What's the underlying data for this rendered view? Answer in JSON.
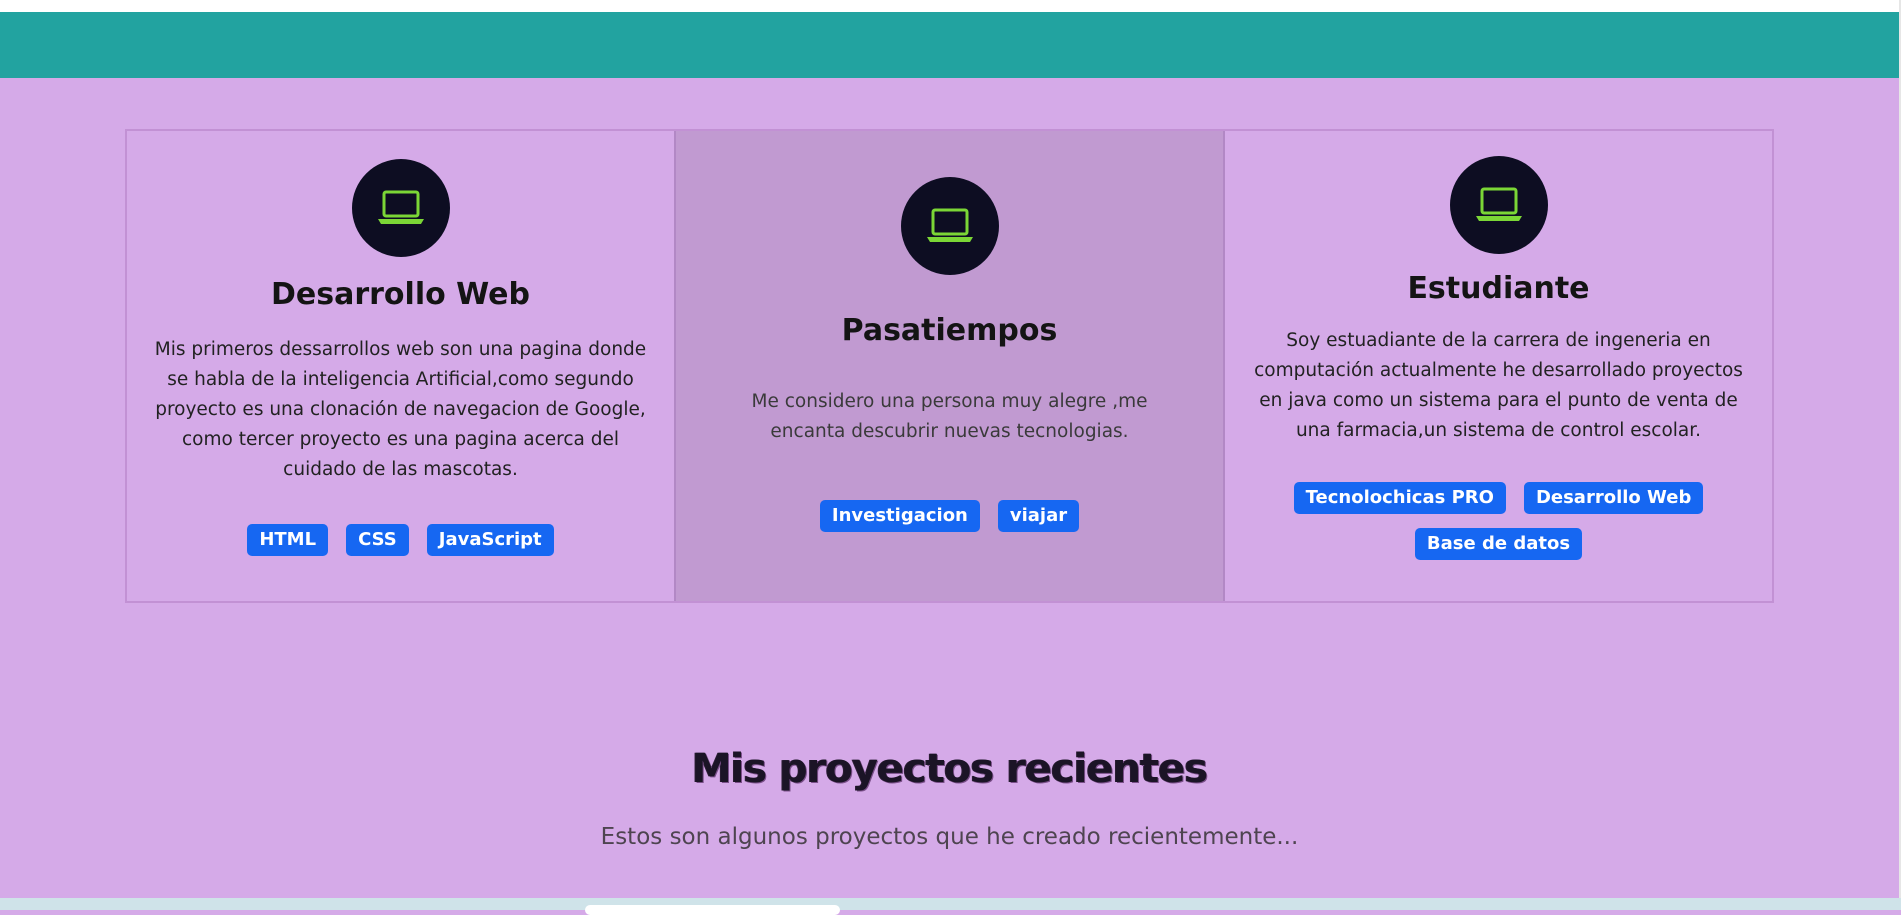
{
  "colors": {
    "page_bg": "#d5aae8",
    "header_bar": "#22a3a0",
    "card_highlight": "#c19ad1",
    "icon_circle": "#0d0d22",
    "icon_color": "#7bd636",
    "tag_bg": "#1667f2"
  },
  "cards": [
    {
      "icon": "laptop-icon",
      "title": "Desarrollo Web",
      "text": "Mis primeros dessarrollos web son una pagina donde se habla de la inteligencia Artificial,como segundo proyecto es una clonación de navegacion de Google, como tercer proyecto es una pagina acerca del cuidado de las mascotas.",
      "tags": [
        "HTML",
        "CSS",
        "JavaScript"
      ]
    },
    {
      "icon": "laptop-icon",
      "title": "Pasatiempos",
      "text": "Me considero una persona muy alegre ,me encanta descubrir nuevas tecnologias.",
      "tags": [
        "Investigacion",
        "viajar"
      ]
    },
    {
      "icon": "laptop-icon",
      "title": "Estudiante",
      "text": "Soy estuadiante de la carrera de ingeneria en computación actualmente he desarrollado proyectos en java como un sistema para el punto de venta de una farmacia,un sistema de control escolar.",
      "tags": [
        "Tecnolochicas PRO",
        "Desarrollo Web",
        "Base de datos"
      ]
    }
  ],
  "projects": {
    "title": "Mis proyectos recientes",
    "subtitle": "Estos son algunos proyectos que he creado recientemente..."
  }
}
